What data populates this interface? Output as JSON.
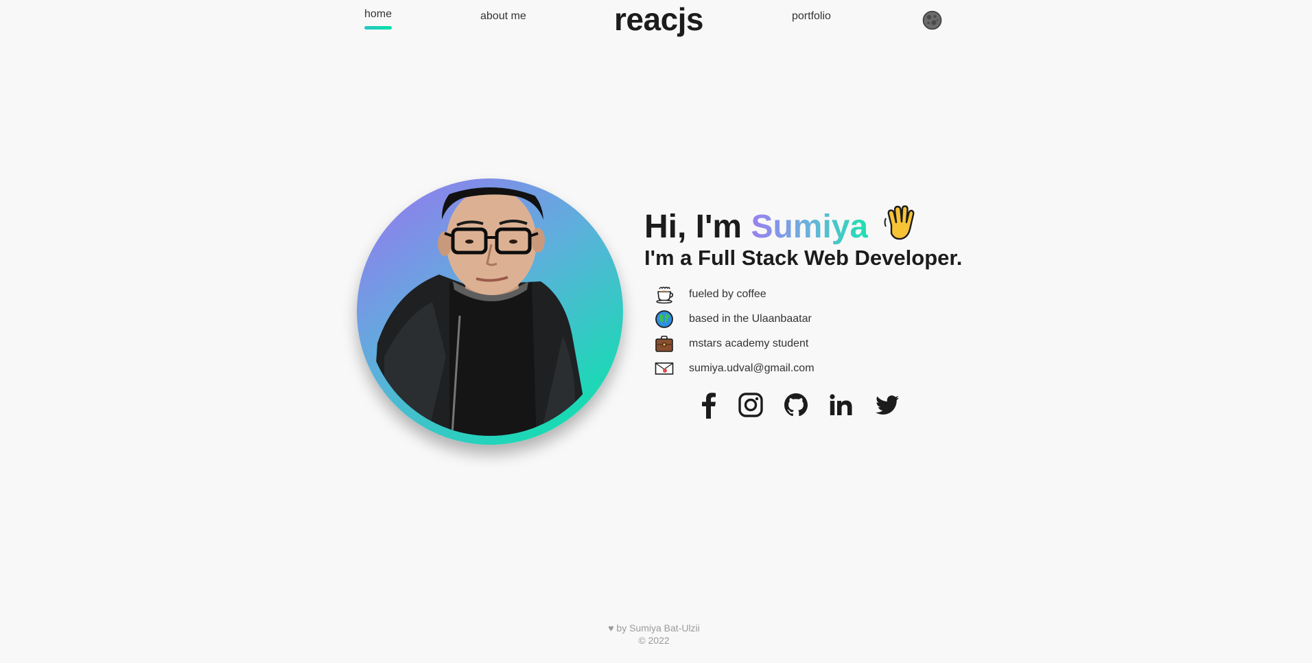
{
  "nav": {
    "home_label": "home",
    "about_label": "about me",
    "logo_text": "reacjs",
    "portfolio_label": "portfolio",
    "theme_toggle_icon": "moon-icon",
    "active_underline_colors": [
      "#2cc3c4",
      "#00e4a6"
    ]
  },
  "intro": {
    "greeting_prefix": "Hi, I'm",
    "name": "Sumiya",
    "greeting_icon": "waving-hand-icon",
    "headline": "I'm a Full Stack Web Developer.",
    "name_gradient": [
      "#9a7ef0",
      "#6ab2dc",
      "#1fe0b0"
    ],
    "avatar_ring_gradient": [
      "#9a74f0",
      "#5db0dc",
      "#00e9a5"
    ],
    "facts": [
      {
        "icon": "coffee-icon",
        "text": "fueled by coffee"
      },
      {
        "icon": "globe-icon",
        "text": "based in the Ulaanbaatar"
      },
      {
        "icon": "briefcase-icon",
        "text": "mstars academy student"
      },
      {
        "icon": "envelope-icon",
        "text": "sumiya.udval@gmail.com"
      }
    ]
  },
  "social": [
    {
      "icon": "facebook-icon"
    },
    {
      "icon": "instagram-icon"
    },
    {
      "icon": "github-icon"
    },
    {
      "icon": "linkedin-icon"
    },
    {
      "icon": "twitter-icon"
    }
  ],
  "footer": {
    "credit": "♥ by Sumiya Bat-Ulzii",
    "copyright": "© 2022"
  }
}
